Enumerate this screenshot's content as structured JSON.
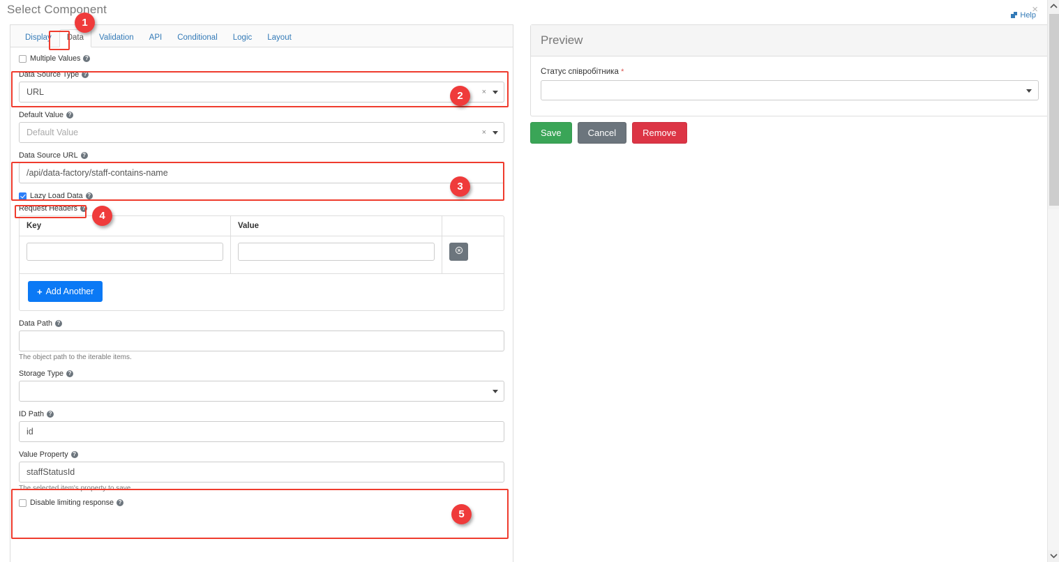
{
  "modal": {
    "title": "Select Component",
    "close_label": "×",
    "help_label": "Help"
  },
  "tabs": [
    {
      "label": "Display",
      "active": false
    },
    {
      "label": "Data",
      "active": true
    },
    {
      "label": "Validation",
      "active": false
    },
    {
      "label": "API",
      "active": false
    },
    {
      "label": "Conditional",
      "active": false
    },
    {
      "label": "Logic",
      "active": false
    },
    {
      "label": "Layout",
      "active": false
    }
  ],
  "form": {
    "multiple_values": {
      "label": "Multiple Values",
      "checked": false
    },
    "data_source_type": {
      "label": "Data Source Type",
      "value": "URL",
      "clear_glyph": "×"
    },
    "default_value": {
      "label": "Default Value",
      "value": "",
      "placeholder": "Default Value",
      "clear_glyph": "×"
    },
    "data_source_url": {
      "label": "Data Source URL",
      "value": "/api/data-factory/staff-contains-name"
    },
    "lazy_load": {
      "label": "Lazy Load Data",
      "checked": true
    },
    "request_headers": {
      "label": "Request Headers",
      "columns": [
        "Key",
        "Value",
        ""
      ],
      "rows": [
        {
          "key": "",
          "value": ""
        }
      ],
      "add_label": "Add Another",
      "add_plus": "+"
    },
    "data_path": {
      "label": "Data Path",
      "value": "",
      "hint": "The object path to the iterable items."
    },
    "storage_type": {
      "label": "Storage Type",
      "value": ""
    },
    "id_path": {
      "label": "ID Path",
      "value": "id"
    },
    "value_property": {
      "label": "Value Property",
      "value": "staffStatusId",
      "hint": "The selected item's property to save."
    },
    "disable_limiting": {
      "label": "Disable limiting response",
      "checked": false
    }
  },
  "preview": {
    "header": "Preview",
    "field_label": "Статус співробітника",
    "required_marker": "*",
    "field_value": ""
  },
  "actions": {
    "save": "Save",
    "cancel": "Cancel",
    "remove": "Remove"
  },
  "annotations": {
    "badges": [
      "1",
      "2",
      "3",
      "4",
      "5"
    ]
  },
  "colors": {
    "accent_blue": "#337ab7",
    "annotation_red": "#ef3b2d",
    "badge_red": "#ef3b3b",
    "save_green": "#3aa557",
    "cancel_gray": "#6c757d",
    "remove_red": "#dc3545",
    "checkbox_blue": "#2d7ff9",
    "add_button_blue": "#0b79f5"
  },
  "help_glyph": "?"
}
